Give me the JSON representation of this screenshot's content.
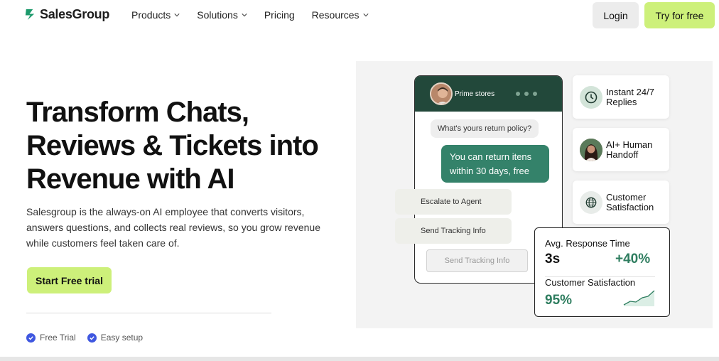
{
  "brand": {
    "name": "SalesGroup",
    "accent": "#cdf07a",
    "dark_green": "#22483a",
    "green": "#34826a"
  },
  "nav": {
    "items": [
      {
        "label": "Products",
        "has_dropdown": true
      },
      {
        "label": "Solutions",
        "has_dropdown": true
      },
      {
        "label": "Pricing",
        "has_dropdown": false
      },
      {
        "label": "Resources",
        "has_dropdown": true
      }
    ],
    "login_label": "Login",
    "try_label": "Try for free"
  },
  "hero": {
    "headline": "Transform Chats, Reviews & Tickets into Revenue with AI",
    "subtext": "Salesgroup is the always-on AI employee that converts visitors, answers questions, and collects real reviews, so you grow revenue while customers feel taken care of.",
    "cta_label": "Start Free trial",
    "features": [
      "Free Trial",
      "Easy setup"
    ]
  },
  "chat": {
    "store_name": "Prime stores",
    "question": "What's yours return policy?",
    "answer": "You can return itens within 30 days, free",
    "actions": [
      "Escalate to Agent",
      "Send Tracking Info"
    ],
    "input_placeholder": "Send Tracking Info"
  },
  "cards": [
    {
      "icon": "clock-icon",
      "label": "Instant 24/7 Replies"
    },
    {
      "icon": "avatar",
      "label": "AI+ Human Handoff"
    },
    {
      "icon": "globe-icon",
      "label": "Customer Satisfaction"
    }
  ],
  "stats": {
    "response_label": "Avg. Response Time",
    "response_value": "3s",
    "response_change": "+40%",
    "satisfaction_label": "Customer Satisfaction",
    "satisfaction_value": "95%"
  }
}
